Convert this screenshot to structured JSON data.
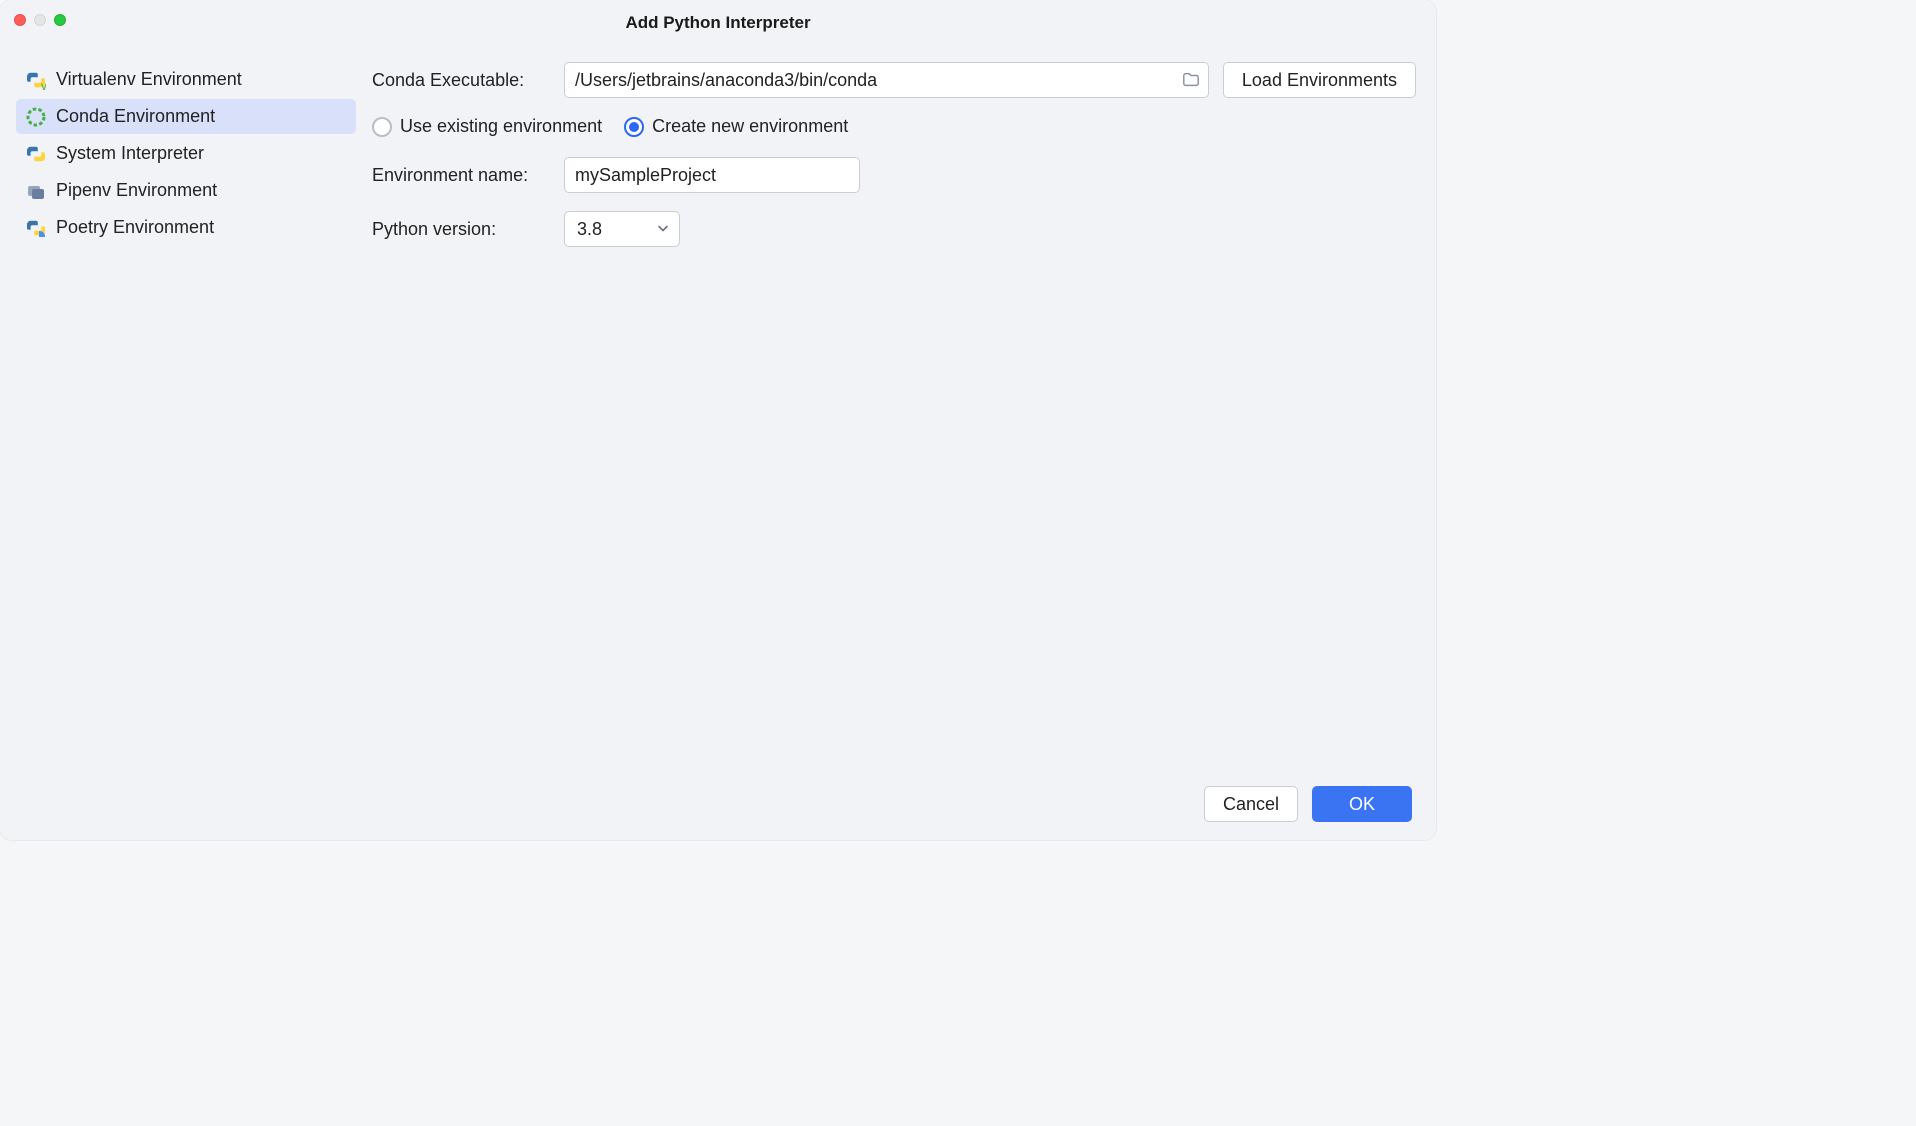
{
  "window": {
    "title": "Add Python Interpreter"
  },
  "sidebar": {
    "items": [
      {
        "label": "Virtualenv Environment",
        "icon": "python-v-icon",
        "selected": false
      },
      {
        "label": "Conda Environment",
        "icon": "anaconda-icon",
        "selected": true
      },
      {
        "label": "System Interpreter",
        "icon": "python-icon",
        "selected": false
      },
      {
        "label": "Pipenv Environment",
        "icon": "pipenv-icon",
        "selected": false
      },
      {
        "label": "Poetry Environment",
        "icon": "poetry-icon",
        "selected": false
      }
    ]
  },
  "form": {
    "conda_executable_label": "Conda Executable:",
    "conda_executable_value": "/Users/jetbrains/anaconda3/bin/conda",
    "load_envs_label": "Load Environments",
    "radio_use_existing": "Use existing environment",
    "radio_create_new": "Create new environment",
    "radio_selected": "create_new",
    "env_name_label": "Environment name:",
    "env_name_value": "mySampleProject",
    "python_version_label": "Python version:",
    "python_version_value": "3.8"
  },
  "footer": {
    "cancel": "Cancel",
    "ok": "OK"
  }
}
